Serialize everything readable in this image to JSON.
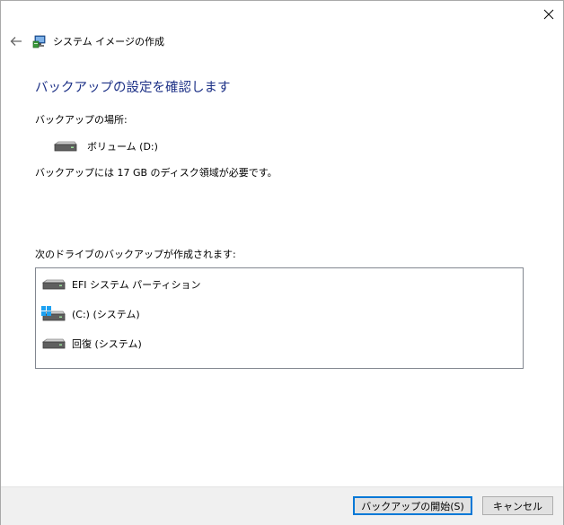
{
  "window": {
    "title": "システム イメージの作成"
  },
  "content": {
    "heading": "バックアップの設定を確認します",
    "location_label": "バックアップの場所:",
    "location_value": "ボリューム (D:)",
    "space_note": "バックアップには 17 GB のディスク領域が必要です。",
    "drives_label": "次のドライブのバックアップが作成されます:",
    "drives": [
      {
        "label": "EFI システム パーティション",
        "icon": "drive-icon"
      },
      {
        "label": "(C:) (システム)",
        "icon": "windows-drive-icon"
      },
      {
        "label": "回復 (システム)",
        "icon": "drive-icon"
      }
    ]
  },
  "footer": {
    "start_button": "バックアップの開始(S)",
    "cancel_button": "キャンセル"
  },
  "colors": {
    "heading": "#1e3287",
    "accent": "#0078d7",
    "footer_bg": "#f0f0f0"
  }
}
